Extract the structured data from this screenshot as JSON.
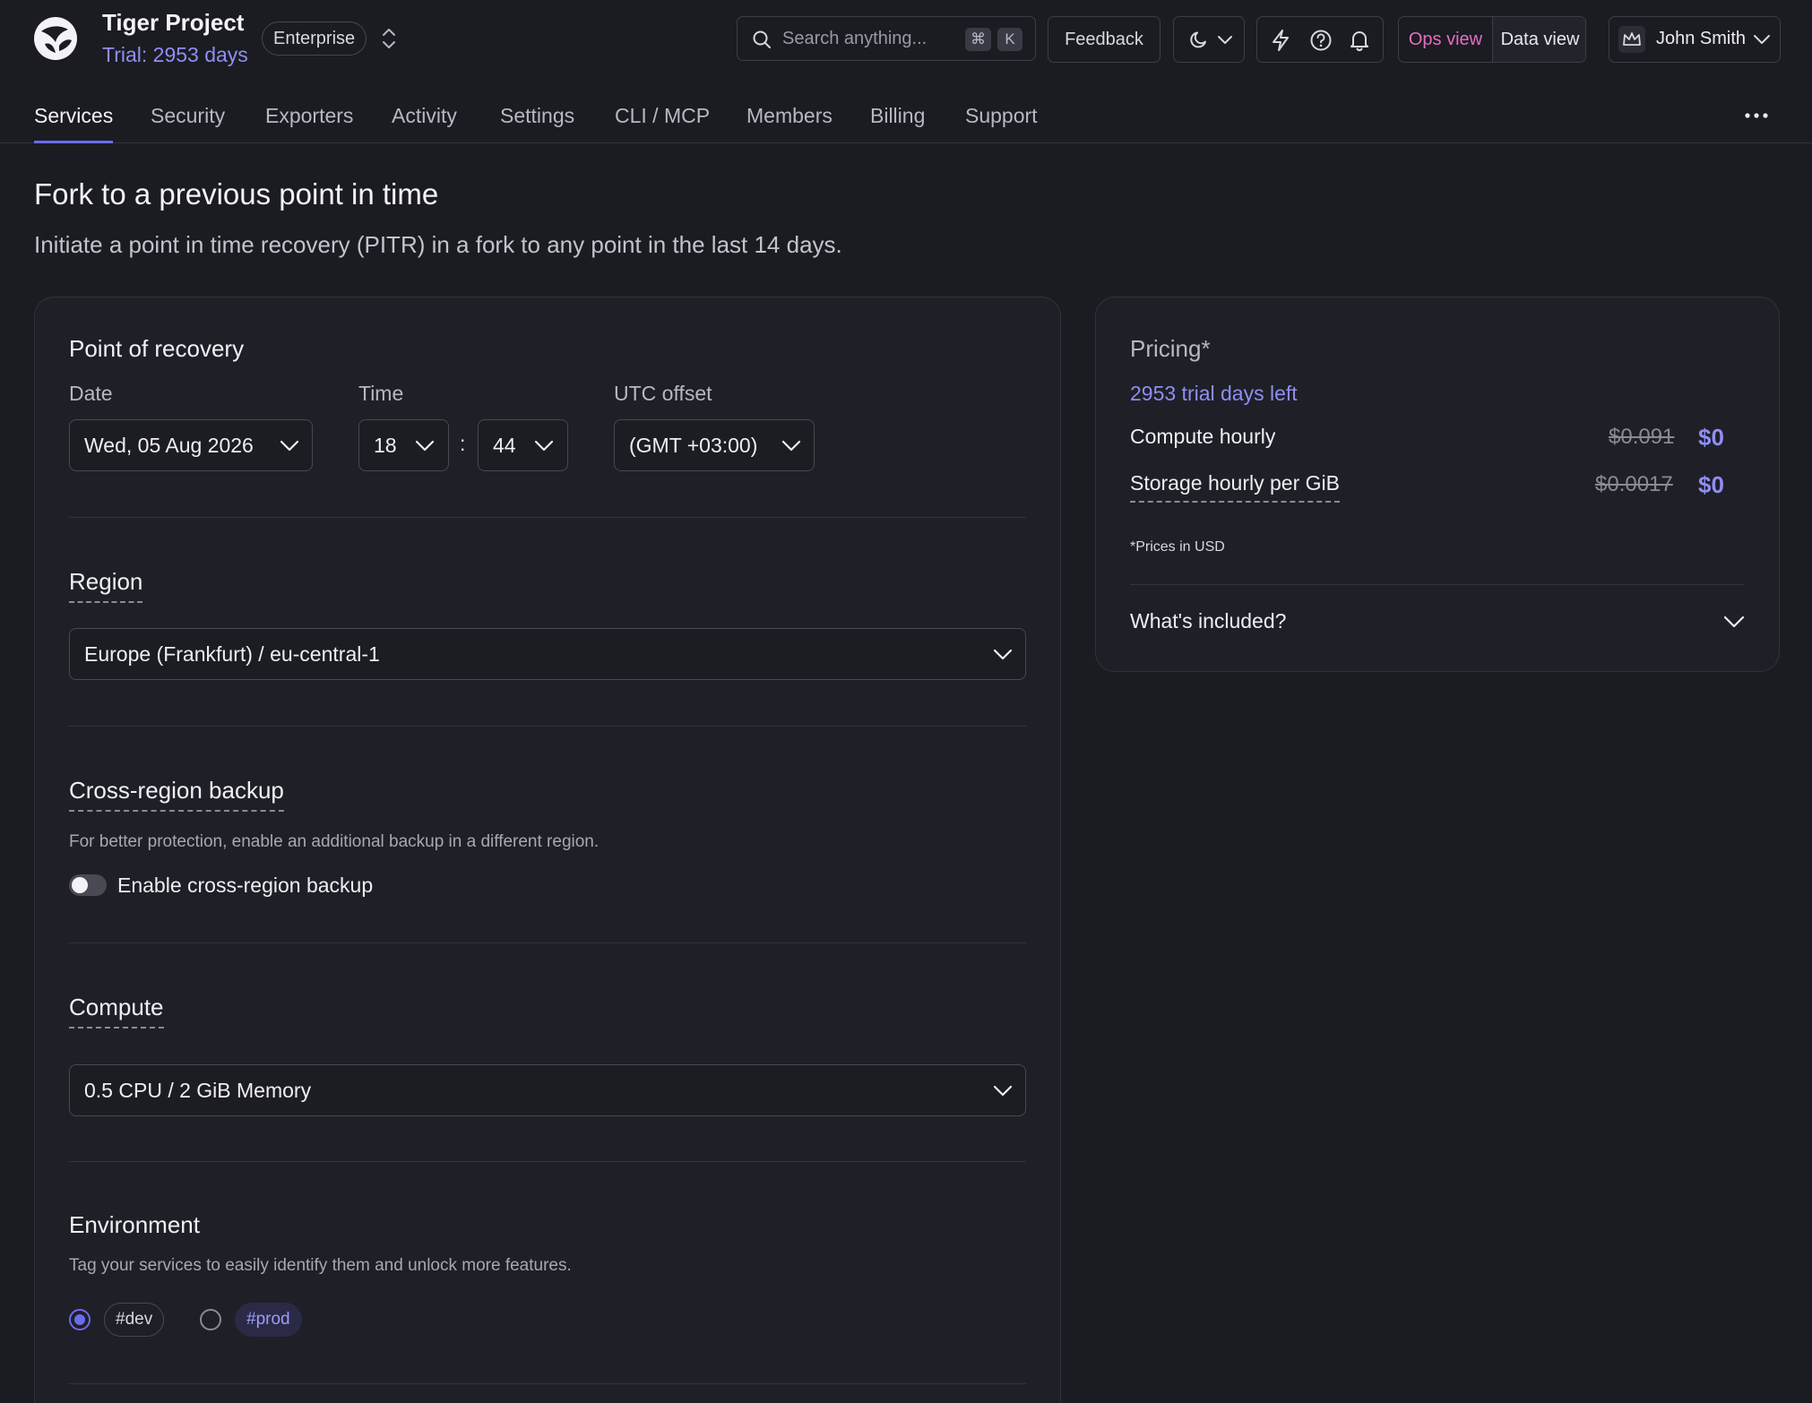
{
  "header": {
    "project_name": "Tiger Project",
    "trial_text": "Trial: 2953 days",
    "plan_badge": "Enterprise",
    "search": {
      "placeholder": "Search anything...",
      "shortcut_mod": "⌘",
      "shortcut_key": "K"
    },
    "feedback_label": "Feedback",
    "theme_icon": "moon-icon",
    "icons": [
      "lightning-icon",
      "help-icon",
      "bell-icon"
    ],
    "view_toggle": {
      "ops_label": "Ops view",
      "data_label": "Data view",
      "selected": "Data view"
    },
    "user_name": "John Smith",
    "colors": {
      "accent": "#6b6bf0",
      "ops_view": "#e36fc2",
      "trial": "#8f8ef4"
    }
  },
  "tabs": [
    {
      "label": "Services",
      "active": true
    },
    {
      "label": "Security"
    },
    {
      "label": "Exporters"
    },
    {
      "label": "Activity"
    },
    {
      "label": "Settings"
    },
    {
      "label": "CLI / MCP"
    },
    {
      "label": "Members"
    },
    {
      "label": "Billing"
    },
    {
      "label": "Support"
    }
  ],
  "page": {
    "title": "Fork to a previous point in time",
    "subtitle": "Initiate a point in time recovery (PITR) in a fork to any point in the last 14 days."
  },
  "recovery": {
    "title": "Point of recovery",
    "date_label": "Date",
    "date_value": "Wed, 05 Aug 2026",
    "time_label": "Time",
    "hour_value": "18",
    "separator": ":",
    "minute_value": "44",
    "utc_label": "UTC offset",
    "utc_value": "(GMT +03:00)"
  },
  "region": {
    "title": "Region",
    "value": "Europe (Frankfurt) / eu-central-1"
  },
  "backup": {
    "title": "Cross-region backup",
    "hint": "For better protection, enable an additional backup in a different region.",
    "toggle_label": "Enable cross-region backup",
    "enabled": false
  },
  "compute": {
    "title": "Compute",
    "value": "0.5 CPU / 2 GiB Memory"
  },
  "environment": {
    "title": "Environment",
    "hint": "Tag your services to easily identify them and unlock more features.",
    "options": [
      {
        "label": "#dev",
        "selected": true
      },
      {
        "label": "#prod",
        "selected": false
      }
    ]
  },
  "pricing": {
    "title": "Pricing*",
    "trial_left": "2953 trial days left",
    "rows": [
      {
        "label": "Compute hourly",
        "old_price": "$0.091",
        "new_price": "$0"
      },
      {
        "label": "Storage hourly per GiB",
        "old_price": "$0.0017",
        "new_price": "$0"
      }
    ],
    "note": "*Prices in USD",
    "included_label": "What's included?"
  }
}
